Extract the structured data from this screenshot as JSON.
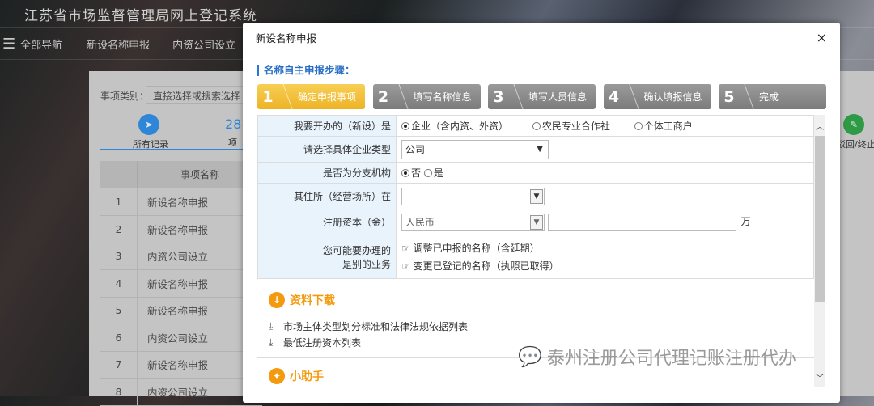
{
  "site": {
    "title": "江苏省市场监督管理局网上登记系统"
  },
  "nav": {
    "all_label": "全部导航",
    "items": [
      "新设名称申报",
      "内资公司设立"
    ]
  },
  "background": {
    "filter_label": "事项类别：",
    "filter_placeholder": "直接选择或搜索选择",
    "all_records": "所有记录",
    "count": "28",
    "count_unit": "项",
    "reject_label": "驳回/终止",
    "column_header": "事项名称",
    "rows": [
      {
        "n": "1",
        "t": "新设名称申报"
      },
      {
        "n": "2",
        "t": "新设名称申报"
      },
      {
        "n": "3",
        "t": "内资公司设立"
      },
      {
        "n": "4",
        "t": "新设名称申报"
      },
      {
        "n": "5",
        "t": "新设名称申报"
      },
      {
        "n": "6",
        "t": "内资公司设立"
      },
      {
        "n": "7",
        "t": "新设名称申报"
      },
      {
        "n": "8",
        "t": "内资公司设立"
      }
    ]
  },
  "modal": {
    "title": "新设名称申报",
    "close": "×",
    "steps_title": "名称自主申报步骤：",
    "steps": [
      {
        "num": "1",
        "label": "确定申报事项"
      },
      {
        "num": "2",
        "label": "填写名称信息"
      },
      {
        "num": "3",
        "label": "填写人员信息"
      },
      {
        "num": "4",
        "label": "确认填报信息"
      },
      {
        "num": "5",
        "label": "完成"
      }
    ],
    "form": {
      "type_label": "我要开办的（新设）是",
      "type_options": [
        "企业（含内资、外资）",
        "农民专业合作社",
        "个体工商户"
      ],
      "company_type_label": "请选择具体企业类型",
      "company_type_value": "公司",
      "branch_label": "是否为分支机构",
      "branch_options": [
        "否",
        "是"
      ],
      "address_label": "其住所（经营场所）在",
      "address_value": "",
      "capital_label": "注册资本（金）",
      "currency_value": "人民币",
      "capital_value": "",
      "capital_unit": "万",
      "other_label_1": "您可能要办理的",
      "other_label_2": "是别的业务",
      "other_links": [
        "调整已申报的名称（含延期）",
        "变更已登记的名称（执照已取得）"
      ]
    },
    "downloads": {
      "title": "资料下载",
      "items": [
        "市场主体类型划分标准和法律法规依据列表",
        "最低注册资本列表"
      ]
    },
    "helper": {
      "title": "小助手"
    }
  },
  "watermark": "泰州注册公司代理记账注册代办"
}
